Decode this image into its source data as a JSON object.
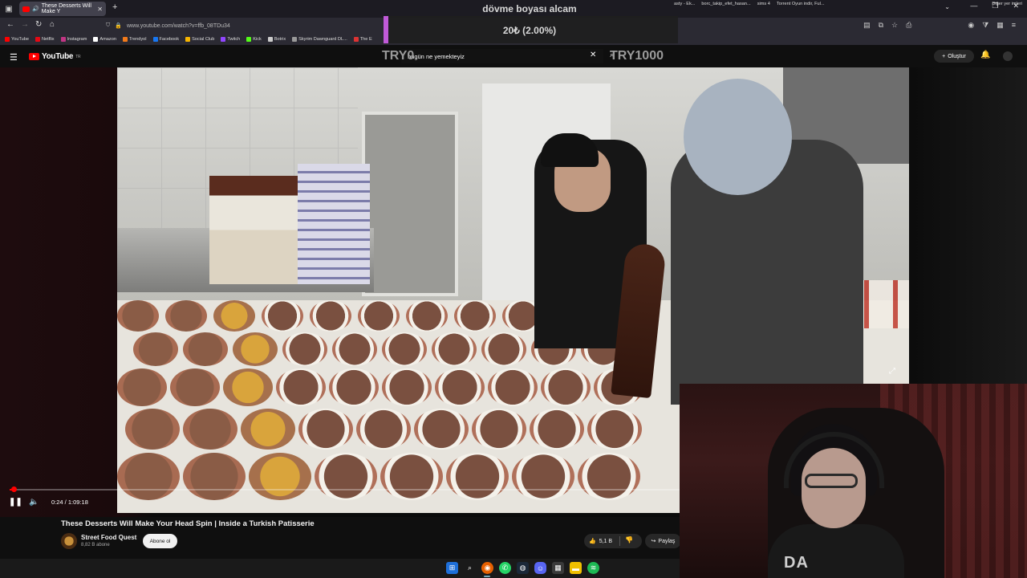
{
  "browser": {
    "tab_title": "These Desserts Will Make Y",
    "url": "www.youtube.com/watch?v=ffb_08TDu34",
    "bookmarks": [
      "YouTube",
      "Netflix",
      "Instagram",
      "Amazon",
      "Trendyol",
      "Facebook",
      "Social Club",
      "Twitch",
      "Kick",
      "Botrix",
      "Skyrim Dawnguard DL...",
      "The E"
    ],
    "bookmarks_mid": [
      "asty - Ek...",
      "borc_takip_efet_hasan...",
      "sims 4",
      "Torrent Oyun indir, Ful..."
    ],
    "bookmarks_other": "Diğer yer imleri"
  },
  "overlay": {
    "title": "dövme boyası alcam",
    "amount": "20₺ (2.00%)",
    "goal_start": "TRY0",
    "goal_end": "TRY1000"
  },
  "youtube": {
    "logo": "YouTube",
    "logo_country": "TR",
    "search_value": "bugün ne yemekteyiz",
    "create_label": "Oluştur",
    "player": {
      "time": "0:24 / 1:09:18",
      "progress": 0.0058
    },
    "video": {
      "title": "These Desserts Will Make Your Head Spin | Inside a Turkish Patisserie",
      "channel": "Street Food Quest",
      "subscribers": "8,82 B abone",
      "subscribe_label": "Abone ol",
      "likes": "5,1 B",
      "share_label": "Paylaş"
    }
  },
  "webcam": {
    "shirt_text": "DA"
  },
  "colors": {
    "accent": "#ff0000",
    "overlay_bar": "#c05ad8"
  }
}
